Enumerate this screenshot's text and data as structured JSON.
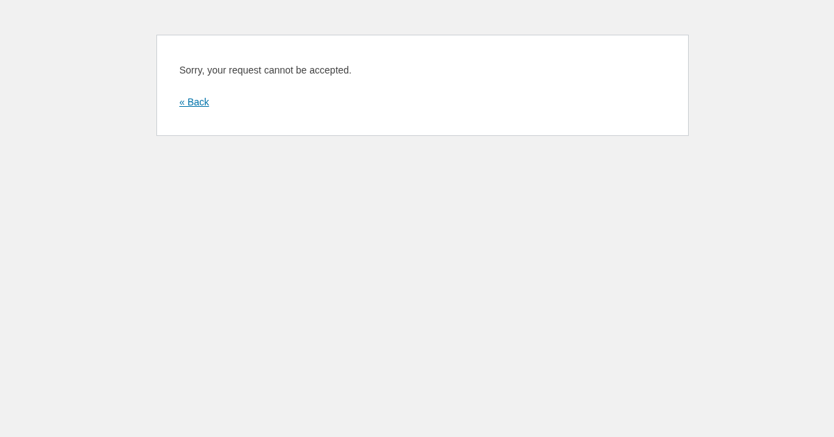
{
  "message": "Sorry, your request cannot be accepted.",
  "back_link": "« Back"
}
